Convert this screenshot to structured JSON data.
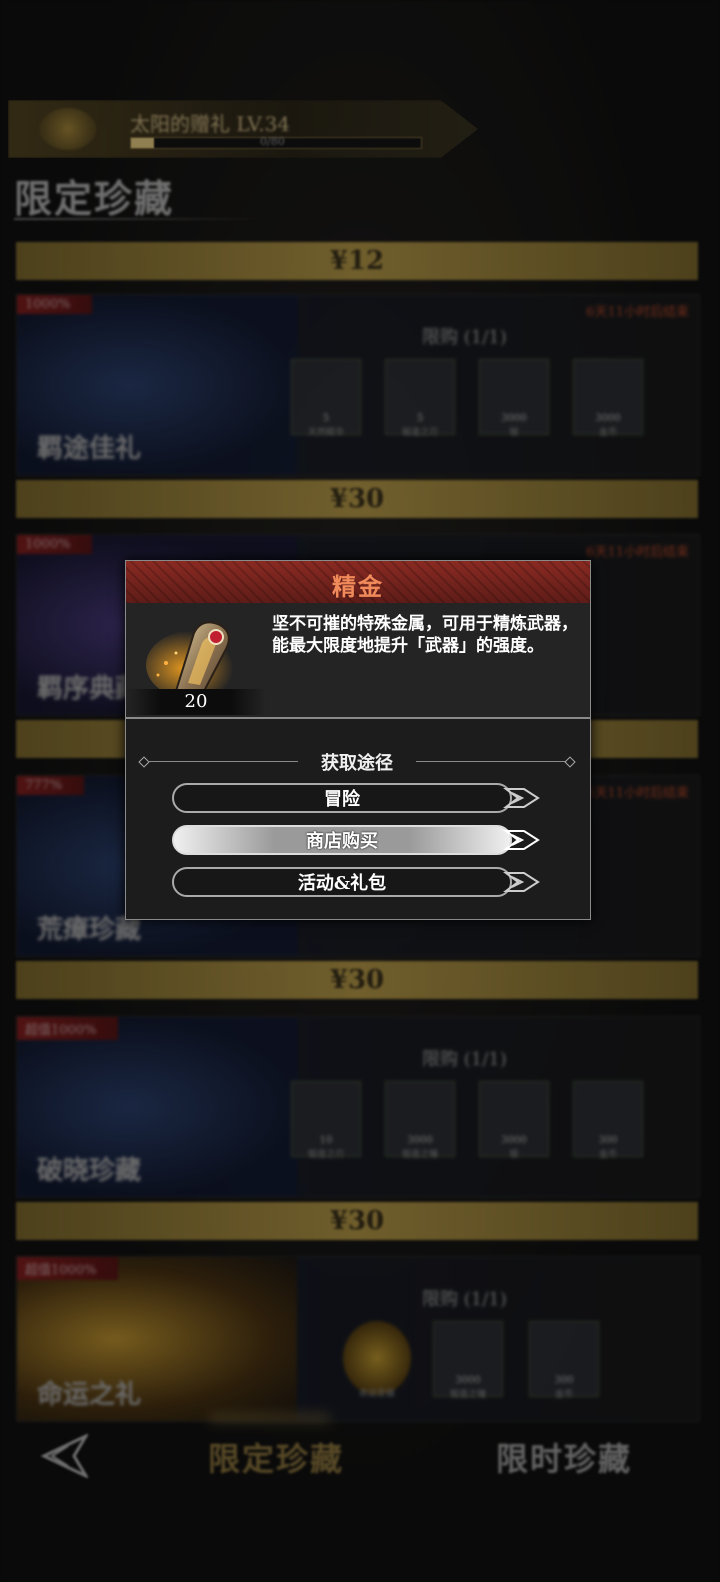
{
  "header": {
    "pass_title": "太阳的赠礼 LV.34",
    "progress_value": "0/80",
    "progress_fraction": 0.08,
    "section_title": "限定珍藏"
  },
  "price_bars": [
    "¥12",
    "¥30",
    "¥30",
    "¥30"
  ],
  "packs": [
    {
      "tag": "1000%",
      "name": "羁途佳礼",
      "timer": "6天11小时后结束",
      "limit": "限购 (1/1)",
      "items": [
        {
          "qty": "5",
          "label": "天然精华"
        },
        {
          "qty": "5",
          "label": "锻造之刃"
        },
        {
          "qty": "3000",
          "label": "银"
        },
        {
          "qty": "3000",
          "label": "金币"
        }
      ]
    },
    {
      "tag": "1000%",
      "name": "羁序典藏",
      "timer": "6天11小时后结束"
    },
    {
      "tag": "777%",
      "name": "荒瘴珍藏",
      "timer": "6天11小时后结束"
    },
    {
      "tag": "超值1000%",
      "name": "破晓珍藏",
      "limit": "限购 (1/1)",
      "items": [
        {
          "qty": "10",
          "label": "锻造之刃"
        },
        {
          "qty": "3000",
          "label": "锻造之锤"
        },
        {
          "qty": "3000",
          "label": "银"
        },
        {
          "qty": "300",
          "label": "金币"
        }
      ]
    },
    {
      "tag": "超值1000%",
      "name": "命运之礼",
      "limit": "限购 (1/1)",
      "items": [
        {
          "qty": "",
          "label": "命运圣徽"
        },
        {
          "qty": "3000",
          "label": "锻造之锤"
        },
        {
          "qty": "300",
          "label": "金币"
        }
      ]
    }
  ],
  "nav": {
    "tab_limited": "限定珍藏",
    "tab_timed": "限时珍藏"
  },
  "popup": {
    "title": "精金",
    "item_count": "20",
    "description": "坚不可摧的特殊金属，可用于精炼武器，能最大限度地提升「武器」的强度。",
    "source_heading": "获取途径",
    "sources": [
      "冒险",
      "商店购买",
      "活动&礼包"
    ],
    "highlighted_source": "商店购买",
    "title_color": "#f08a5a",
    "header_color": "#7a2420"
  }
}
